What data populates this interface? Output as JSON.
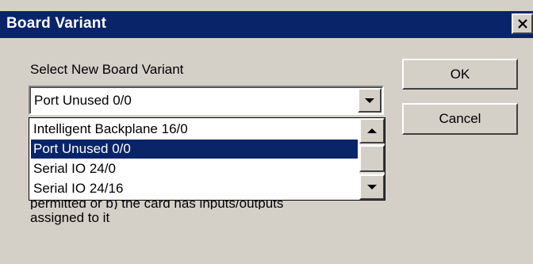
{
  "dialog": {
    "title": "Board Variant",
    "close_glyph": "✕"
  },
  "form": {
    "label": "Select New Board Variant",
    "combo_value": "Port Unused 0/0",
    "options": [
      "Intelligent Backplane 16/0",
      "Port Unused 0/0",
      "Serial IO 24/0",
      "Serial IO 24/16"
    ],
    "selected_option": "Port Unused 0/0"
  },
  "help": {
    "line_partial": "permitted or b) the card has inputs/outputs",
    "line_2": "assigned to it"
  },
  "buttons": {
    "ok": "OK",
    "cancel": "Cancel"
  },
  "icons": {
    "close": "close-icon",
    "combo_arrow": "chevron-down-icon",
    "scroll_up": "scroll-up-icon",
    "scroll_down": "scroll-down-icon"
  }
}
